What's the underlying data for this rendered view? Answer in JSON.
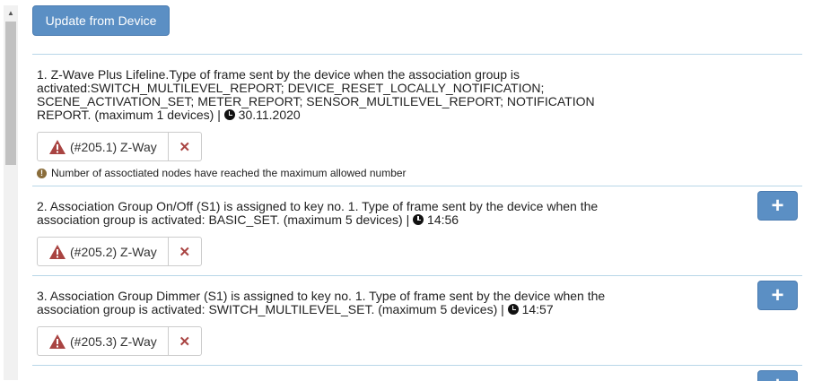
{
  "toolbar": {
    "update_label": "Update from Device"
  },
  "groups": [
    {
      "description": "1. Z-Wave Plus Lifeline.Type of frame sent by the device when the association group is activated:SWITCH_MULTILEVEL_REPORT; DEVICE_RESET_LOCALLY_NOTIFICATION; SCENE_ACTIVATION_SET; METER_REPORT; SENSOR_MULTILEVEL_REPORT; NOTIFICATION REPORT. (maximum 1 devices) |",
      "timestamp": "30.11.2020",
      "node_label": "(#205.1) Z-Way",
      "remove_label": "✕",
      "note": "Number of assoctiated nodes have reached the maximum allowed number"
    },
    {
      "description": "2. Association Group On/Off (S1) is assigned to key no. 1. Type of frame sent by the device when the association group is activated: BASIC_SET. (maximum 5 devices) |",
      "timestamp": "14:56",
      "node_label": "(#205.2) Z-Way",
      "remove_label": "✕",
      "add_label": "+"
    },
    {
      "description": "3. Association Group Dimmer (S1) is assigned to key no. 1. Type of frame sent by the device when the association group is activated: SWITCH_MULTILEVEL_SET. (maximum 5 devices) |",
      "timestamp": "14:57",
      "node_label": "(#205.3) Z-Way",
      "remove_label": "✕",
      "add_label": "+"
    },
    {
      "add_label": "+"
    }
  ],
  "icons": {
    "warning": "warning-triangle-icon",
    "remove": "close-icon",
    "clock": "clock-icon",
    "info": "info-circle-icon",
    "add": "plus-icon"
  },
  "colors": {
    "primary_button": "#5b8fc4",
    "warning": "#a94442",
    "divider": "#b8d6e8",
    "note_icon": "#8a6d3b"
  }
}
